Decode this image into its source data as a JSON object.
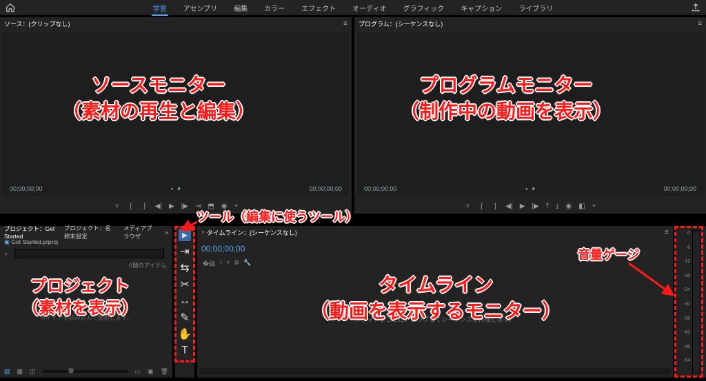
{
  "workspace": {
    "tabs": [
      "学習",
      "アセンブリ",
      "編集",
      "カラー",
      "エフェクト",
      "オーディオ",
      "グラフィック",
      "キャプション",
      "ライブラリ"
    ],
    "active_index": 0
  },
  "source_panel": {
    "tab_label": "ソース：(クリップなし)",
    "timecode_left": "00;00;00;00",
    "timecode_right": "00;00;00;00"
  },
  "program_panel": {
    "tab_label": "プログラム：(シーケンスなし)",
    "timecode_left": "00;00;00;00",
    "timecode_right": "00;00;00;00"
  },
  "project_panel": {
    "tabs": [
      "プロジェクト：Get Started",
      "プロジェクト：名称未設定",
      "メディアブラウザ"
    ],
    "active_index": 0,
    "file_line": "Get Started.prproj",
    "item_count": "0個のアイテム",
    "drop_hint": "メディアを読み込んで開始します。"
  },
  "timeline_panel": {
    "tab_label": "タイムライン：(シーケンスなし)",
    "timecode": "00;00;00;00",
    "drop_hint": "メディアをここにドロップしてシーケンスを作成します。"
  },
  "tools": [
    "selection",
    "track-select",
    "ripple",
    "razor",
    "slip",
    "pen",
    "hand",
    "type"
  ],
  "audio_meter_ticks": [
    "0",
    "-6",
    "-12",
    "-18",
    "-24",
    "-30",
    "-36",
    "-42",
    "-48",
    "-54"
  ],
  "annotations": {
    "source_title": "ソースモニター",
    "source_sub": "（素材の再生と編集）",
    "program_title": "プログラムモニター",
    "program_sub": "（制作中の動画を表示）",
    "tools": "ツール（編集に使うツール）",
    "project_title": "プロジェクト",
    "project_sub": "（素材を表示）",
    "timeline_title": "タイムライン",
    "timeline_sub": "（動画を表示するモニター）",
    "audio": "音量ゲージ"
  }
}
